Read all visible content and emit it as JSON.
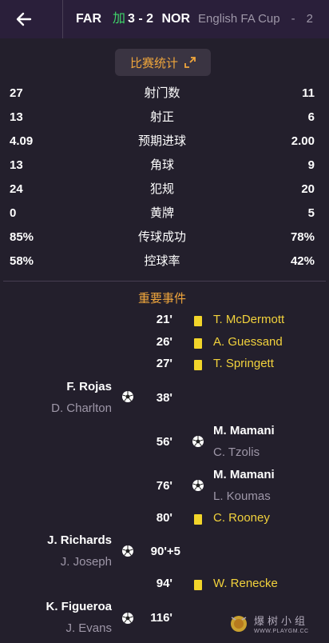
{
  "header": {
    "home_team": "FAR",
    "extra_time_marker": "加",
    "score": "3 - 2",
    "away_team": "NOR",
    "competition": "English FA Cup",
    "separator": "-",
    "overflow_text": "2"
  },
  "stats_button": {
    "label": "比赛统计"
  },
  "stats": [
    {
      "label": "射门数",
      "home": "27",
      "away": "11"
    },
    {
      "label": "射正",
      "home": "13",
      "away": "6"
    },
    {
      "label": "预期进球",
      "home": "4.09",
      "away": "2.00"
    },
    {
      "label": "角球",
      "home": "13",
      "away": "9"
    },
    {
      "label": "犯规",
      "home": "24",
      "away": "20"
    },
    {
      "label": "黄牌",
      "home": "0",
      "away": "5"
    },
    {
      "label": "传球成功",
      "home": "85%",
      "away": "78%"
    },
    {
      "label": "控球率",
      "home": "58%",
      "away": "42%"
    }
  ],
  "events_title": "重要事件",
  "events": {
    "e1": {
      "minute": "21'",
      "player": "T. McDermott",
      "type": "yellow-card",
      "side": "away"
    },
    "e2": {
      "minute": "26'",
      "player": "A. Guessand",
      "type": "yellow-card",
      "side": "away"
    },
    "e3": {
      "minute": "27'",
      "player": "T. Springett",
      "type": "yellow-card",
      "side": "away"
    },
    "e4": {
      "minute": "38'",
      "player": "F. Rojas",
      "assist": "D. Charlton",
      "type": "goal",
      "side": "home"
    },
    "e5": {
      "minute": "56'",
      "player": "M. Mamani",
      "assist": "C. Tzolis",
      "type": "goal",
      "side": "away"
    },
    "e6": {
      "minute": "76'",
      "player": "M. Mamani",
      "assist": "L. Koumas",
      "type": "goal",
      "side": "away"
    },
    "e7": {
      "minute": "80'",
      "player": "C. Rooney",
      "type": "yellow-card",
      "side": "away"
    },
    "e8": {
      "minute": "90'+5",
      "player": "J. Richards",
      "assist": "J. Joseph",
      "type": "goal",
      "side": "home"
    },
    "e9": {
      "minute": "94'",
      "player": "W. Renecke",
      "type": "yellow-card",
      "side": "away"
    },
    "e10": {
      "minute": "116'",
      "player": "K. Figueroa",
      "assist": "J. Evans",
      "type": "goal",
      "side": "home"
    }
  },
  "watermark": {
    "line1": "爆树小组",
    "line2": "WWW.PLAYGM.CC"
  },
  "colors": {
    "accent": "#f0a63c",
    "background": "#231f2c",
    "yellow_card": "#f2d52a",
    "extra_time": "#3fd66a"
  }
}
